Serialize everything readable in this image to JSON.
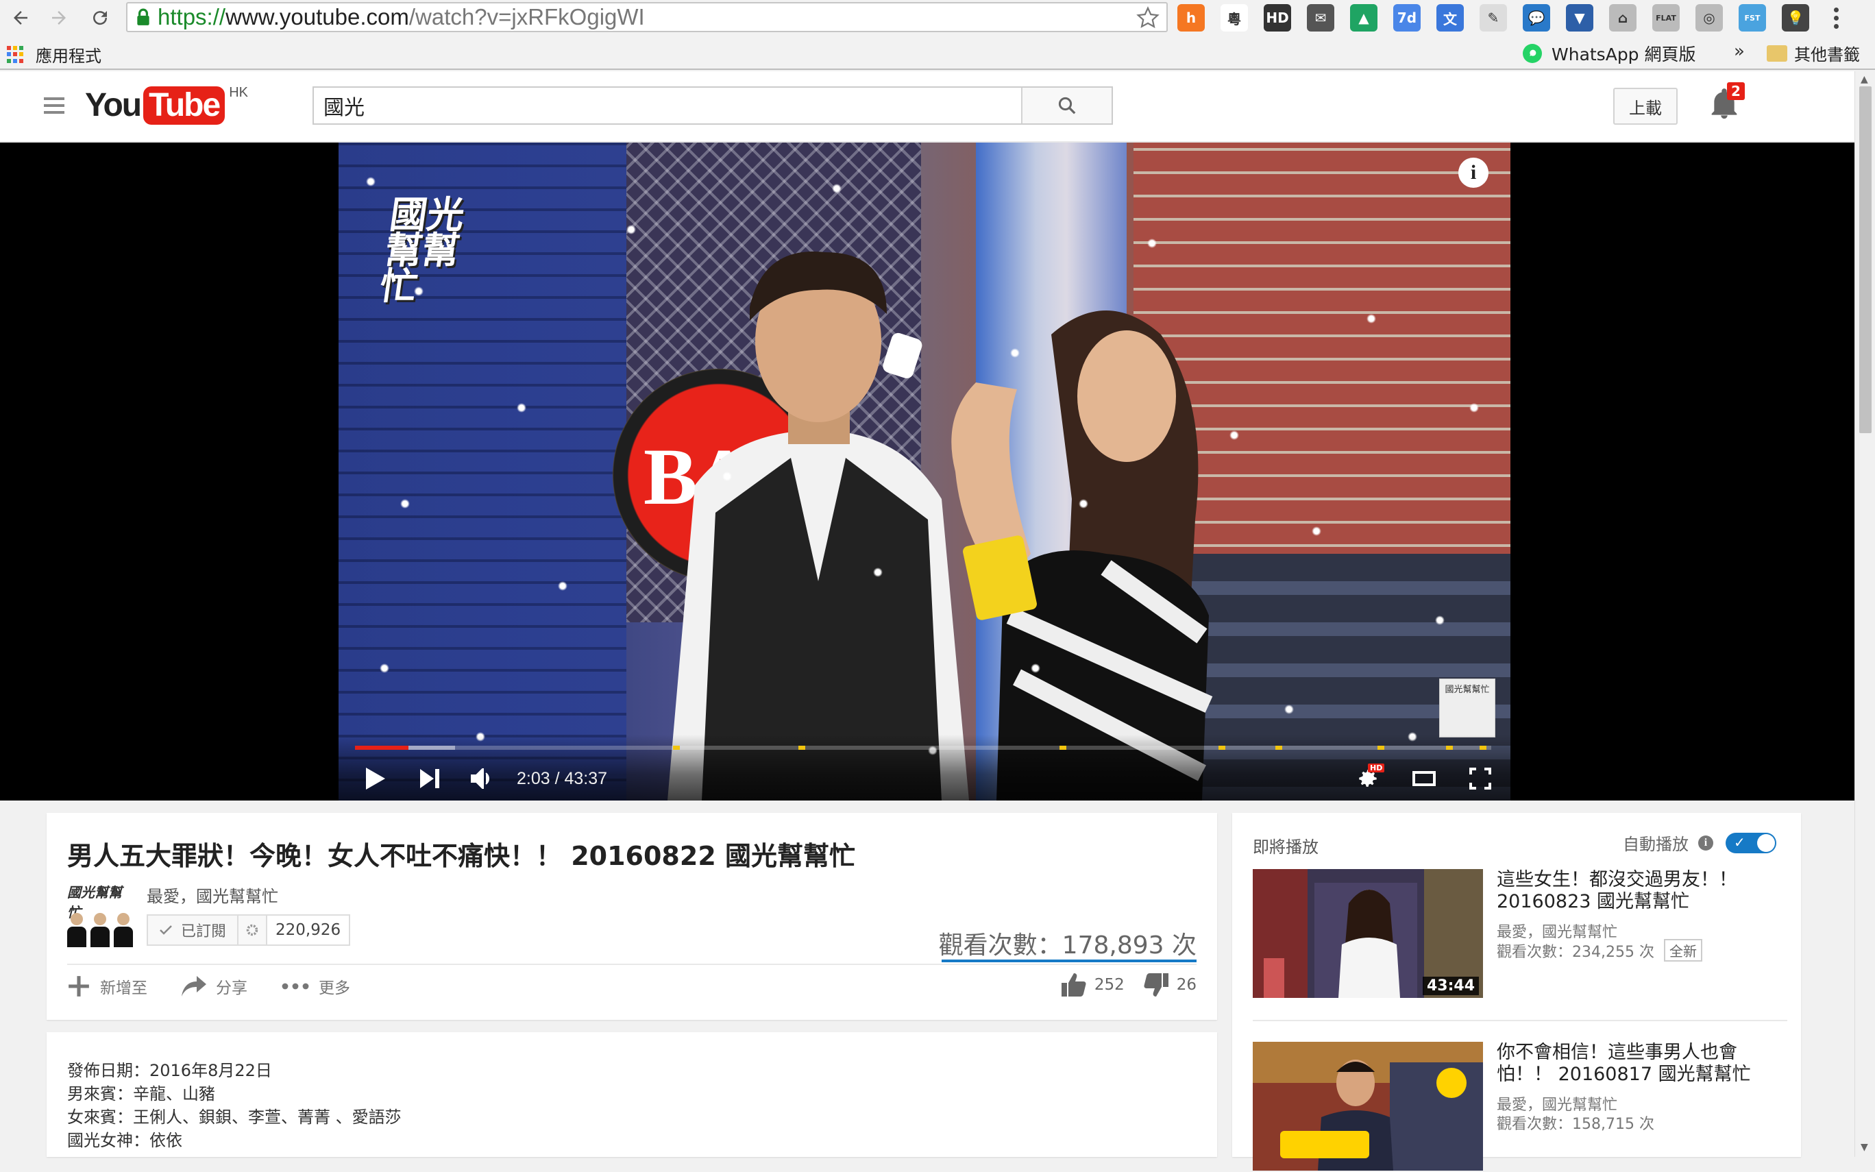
{
  "browser": {
    "url_protocol": "https://",
    "url_host": "www.youtube.com",
    "url_path": "/watch?v=jxRFkOgigWI",
    "extensions": [
      {
        "name": "hubspot-ext-icon",
        "color": "#f57722",
        "glyph": "h"
      },
      {
        "name": "cantonese-ext-icon",
        "color": "#ffffff",
        "glyph": "粵"
      },
      {
        "name": "hd-ext-icon",
        "color": "#333333",
        "glyph": "HD"
      },
      {
        "name": "mail-ext-icon",
        "color": "#555555",
        "glyph": "✉"
      },
      {
        "name": "drive-ext-icon",
        "color": "#1fa463",
        "glyph": "▲"
      },
      {
        "name": "calendar-ext-icon",
        "color": "#4a86e8",
        "glyph": "7d"
      },
      {
        "name": "translate-ext-icon",
        "color": "#3a77db",
        "glyph": "文"
      },
      {
        "name": "pen-ext-icon",
        "color": "#dddddd",
        "glyph": "✎"
      },
      {
        "name": "chat-ext-icon",
        "color": "#2979c9",
        "glyph": "💬"
      },
      {
        "name": "pocket-ext-icon",
        "color": "#2d5fa8",
        "glyph": "▼"
      },
      {
        "name": "evernote-ext-icon",
        "color": "#bbbbbb",
        "glyph": "⌂"
      },
      {
        "name": "flat-ext-icon",
        "color": "#bbbbbb",
        "glyph": "FLAT"
      },
      {
        "name": "instagram-ext-icon",
        "color": "#bbbbbb",
        "glyph": "◎"
      },
      {
        "name": "fst-ext-icon",
        "color": "#4aa3df",
        "glyph": "FST"
      },
      {
        "name": "bulb-ext-icon",
        "color": "#444444",
        "glyph": "💡"
      }
    ]
  },
  "bookmarks": {
    "apps_label": "應用程式",
    "whatsapp_label": "WhatsApp 網頁版",
    "overflow": "»",
    "other_label": "其他書籤"
  },
  "masthead": {
    "logo_you": "You",
    "logo_tube": "Tube",
    "logo_region": "HK",
    "search_value": "國光",
    "upload_label": "上載",
    "notification_count": "2"
  },
  "player": {
    "show_logo": "國光幫幫忙",
    "sign_text": "BAR",
    "info_glyph": "i",
    "corner_logo": "國光幫幫忙",
    "current_time": "2:03",
    "duration": "43:37",
    "time_display": "2:03 / 43:37",
    "played_fraction": 0.047,
    "loaded_fraction": 0.088,
    "marker_fractions": [
      0.28,
      0.39,
      0.62,
      0.76,
      0.81,
      0.9,
      0.96,
      0.99
    ],
    "hd_badge": "HD"
  },
  "video": {
    "title": "男人五大罪狀！今晚！女人不吐不痛快！！ 20160822 國光幫幫忙",
    "channel_name": "最愛，國光幫幫忙",
    "channel_thumb_text": "國光幫幫忙",
    "subscribed_label": "已訂閱",
    "subscriber_count": "220,926",
    "views": "觀看次數：178,893 次",
    "actions": {
      "add_to": "新增至",
      "share": "分享",
      "more": "更多"
    },
    "like_count": "252",
    "dislike_count": "26"
  },
  "description": {
    "publish_date": "發佈日期：2016年8月22日",
    "male_guests": "男來賓：辛龍、山豬",
    "female_guests": "女來賓：王俐人、鋇鋇、李萱、菁菁 、愛語莎",
    "goddess": "國光女神：依依"
  },
  "sidebar": {
    "up_next_label": "即將播放",
    "autoplay_label": "自動播放",
    "items": [
      {
        "title": "這些女生！都沒交過男友！！ 20160823 國光幫幫忙",
        "channel": "最愛，國光幫幫忙",
        "views": "觀看次數：234,255 次",
        "badge": "全新",
        "duration": "43:44"
      },
      {
        "title": "你不會相信！這些事男人也會怕！！ 20160817 國光幫幫忙",
        "channel": "最愛，國光幫幫忙",
        "views": "觀看次數：158,715 次",
        "badge": "",
        "duration": ""
      }
    ]
  },
  "colors": {
    "youtube_red": "#e62117",
    "accent_blue": "#167ac6",
    "progress_marker": "#f1c40f"
  }
}
